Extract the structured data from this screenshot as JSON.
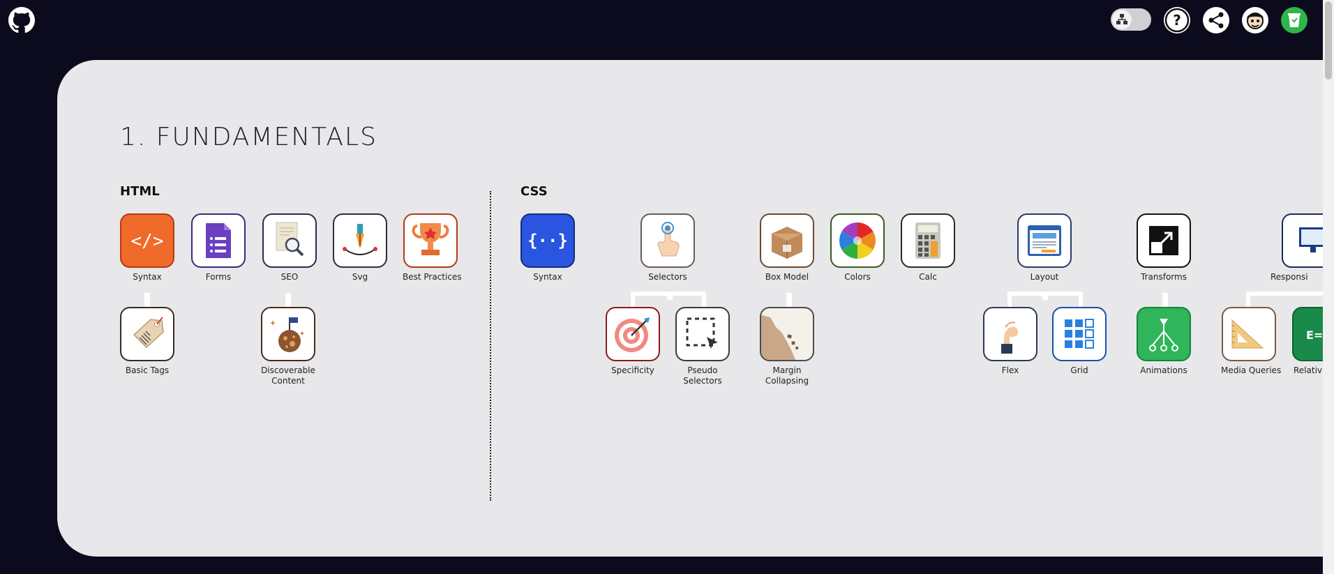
{
  "topbar": {
    "github_icon": "github-icon",
    "toggle_icon": "tree-view-icon",
    "help_icon": "help-icon",
    "share_icon": "share-icon",
    "avatar_icon": "avatar-icon",
    "store_icon": "cup-icon",
    "colors": {
      "background": "#0b0b1d",
      "store": "#2fb54a"
    }
  },
  "section": {
    "title": "1. FUNDAMENTALS"
  },
  "html": {
    "title": "HTML",
    "nodes": {
      "syntax": "Syntax",
      "forms": "Forms",
      "seo": "SEO",
      "svg": "Svg",
      "best_practices": "Best Practices",
      "basic_tags": "Basic Tags",
      "discoverable_content_1": "Discoverable",
      "discoverable_content_2": "Content"
    }
  },
  "css": {
    "title": "CSS",
    "nodes": {
      "syntax": "Syntax",
      "selectors": "Selectors",
      "box_model": "Box Model",
      "colors": "Colors",
      "calc": "Calc",
      "layout": "Layout",
      "transforms": "Transforms",
      "responsive": "Responsi",
      "specificity": "Specificity",
      "pseudo_selectors_1": "Pseudo",
      "pseudo_selectors_2": "Selectors",
      "margin_collapsing_1": "Margin",
      "margin_collapsing_2": "Collapsing",
      "flex": "Flex",
      "grid": "Grid",
      "animations": "Animations",
      "media_queries": "Media Queries",
      "relative": "Relativ"
    }
  }
}
